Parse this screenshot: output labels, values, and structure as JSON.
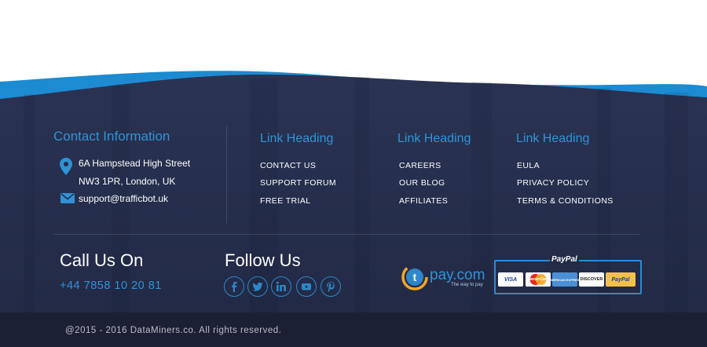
{
  "colors": {
    "footer_bg": "#232b49",
    "accent_blue": "#2f93d6",
    "wave_blue": "#1d8bd1",
    "bottom_bar": "#1c2034"
  },
  "contact": {
    "heading": "Contact Information",
    "address_line1": "6A Hampstead High Street",
    "address_line2": "NW3 1PR, London, UK",
    "email": "support@trafficbot.uk",
    "icons": [
      "map-pin-icon",
      "envelope-icon"
    ]
  },
  "link_columns": [
    {
      "heading": "Link Heading",
      "links": [
        "CONTACT US",
        "SUPPORT FORUM",
        "FREE TRIAL"
      ]
    },
    {
      "heading": "Link Heading",
      "links": [
        "CAREERS",
        "OUR BLOG",
        "AFFILIATES"
      ]
    },
    {
      "heading": "Link Heading",
      "links": [
        "EULA",
        "PRIVACY POLICY",
        "TERMS & CONDITIONS"
      ]
    }
  ],
  "call": {
    "heading": "Call Us On",
    "phone": "+44 7858 10 20 81"
  },
  "follow": {
    "heading": "Follow Us",
    "icons": [
      "facebook-icon",
      "twitter-icon",
      "linkedin-icon",
      "youtube-icon",
      "pinterest-icon"
    ]
  },
  "payments": {
    "tpay_letter": "t",
    "tpay_text": "pay.com",
    "tpay_tagline": "The way to pay",
    "paypal_title": "PayPal",
    "cards": [
      "VISA",
      "MasterCard",
      "AMERICAN EXPRESS",
      "DISCOVER",
      "PayPal"
    ]
  },
  "copyright": "@2015 - 2016 DataMiners.co. All rights reserved."
}
